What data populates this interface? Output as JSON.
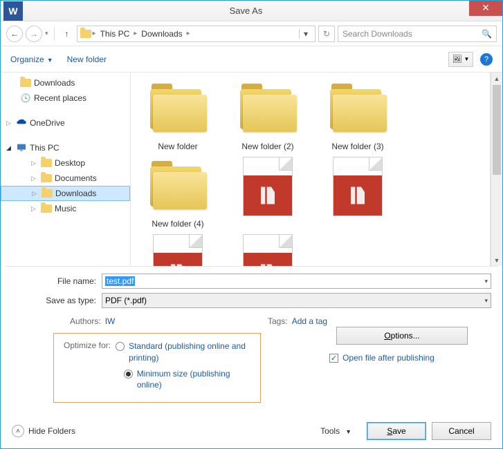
{
  "title": "Save As",
  "app_letter": "W",
  "close_glyph": "✕",
  "nav": {
    "back": "←",
    "fwd": "→",
    "up": "↑",
    "refresh": "↻"
  },
  "breadcrumb": [
    "This PC",
    "Downloads"
  ],
  "search_placeholder": "Search Downloads",
  "toolbar": {
    "organize": "Organize",
    "new_folder": "New folder"
  },
  "tree": {
    "downloads": "Downloads",
    "recent": "Recent places",
    "onedrive": "OneDrive",
    "thispc": "This PC",
    "desktop": "Desktop",
    "documents": "Documents",
    "downloads2": "Downloads",
    "music": "Music"
  },
  "files": {
    "f1": "New folder",
    "f2": "New folder (2)",
    "f3": "New folder (3)",
    "f4": "New folder (4)"
  },
  "filename_label": "File name:",
  "filename_value": "test.pdf",
  "savetype_label": "Save as type:",
  "savetype_value": "PDF (*.pdf)",
  "authors_label": "Authors:",
  "authors_value": "IW",
  "tags_label": "Tags:",
  "tags_value": "Add a tag",
  "optimize_label": "Optimize for:",
  "opt_standard": "Standard (publishing online and printing)",
  "opt_minimum": "Minimum size (publishing online)",
  "options_btn": "Options...",
  "open_after": "Open file after publishing",
  "hide_folders": "Hide Folders",
  "tools": "Tools",
  "save": "Save",
  "cancel": "Cancel"
}
